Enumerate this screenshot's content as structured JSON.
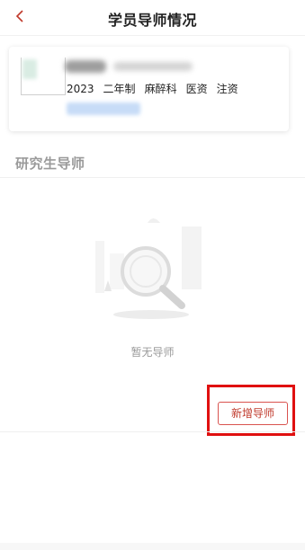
{
  "header": {
    "title": "学员导师情况",
    "back_icon": "chevron-left-icon"
  },
  "student": {
    "tags": [
      "2023",
      "二年制",
      "麻醉科",
      "医资",
      "注资"
    ]
  },
  "section": {
    "title": "研究生导师"
  },
  "empty_state": {
    "text": "暂无导师",
    "icon": "magnifier-empty-icon"
  },
  "actions": {
    "add_label": "新增导师"
  },
  "colors": {
    "accent": "#c0392b",
    "highlight": "#e01010"
  }
}
